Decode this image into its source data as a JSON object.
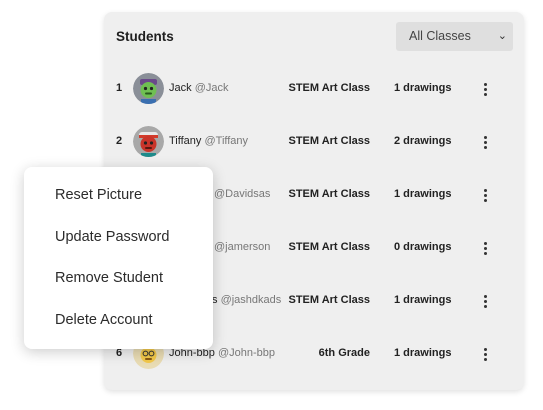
{
  "panel": {
    "title": "Students",
    "class_filter": {
      "selected": "All Classes"
    }
  },
  "students": [
    {
      "rank": "1",
      "name": "Jack",
      "handle": "@Jack",
      "class": "STEM Art Class",
      "drawings": "1 drawings",
      "avatar": "green-face-avatar"
    },
    {
      "rank": "2",
      "name": "Tiffany",
      "handle": "@Tiffany",
      "class": "STEM Art Class",
      "drawings": "2 drawings",
      "avatar": "red-face-avatar"
    },
    {
      "rank": "",
      "name": "",
      "handle": "@Davidsas",
      "class": "STEM Art Class",
      "drawings": "1 drawings",
      "avatar": ""
    },
    {
      "rank": "",
      "name": "",
      "handle": "@jamerson",
      "class": "STEM Art Class",
      "drawings": "0 drawings",
      "avatar": ""
    },
    {
      "rank": "",
      "name": "s",
      "handle": "@jashdkads",
      "class": "STEM Art Class",
      "drawings": "1 drawings",
      "avatar": ""
    },
    {
      "rank": "6",
      "name": "John-bbp",
      "handle": "@John-bbp",
      "class": "6th Grade",
      "drawings": "1 drawings",
      "avatar": "yellow-face-avatar"
    }
  ],
  "context_menu": {
    "items": [
      "Reset Picture",
      "Update Password",
      "Remove Student",
      "Delete Account"
    ]
  },
  "colors": {
    "panel_bg": "#efefef",
    "select_bg": "#dfdfdf",
    "menu_bg": "#ffffff"
  }
}
